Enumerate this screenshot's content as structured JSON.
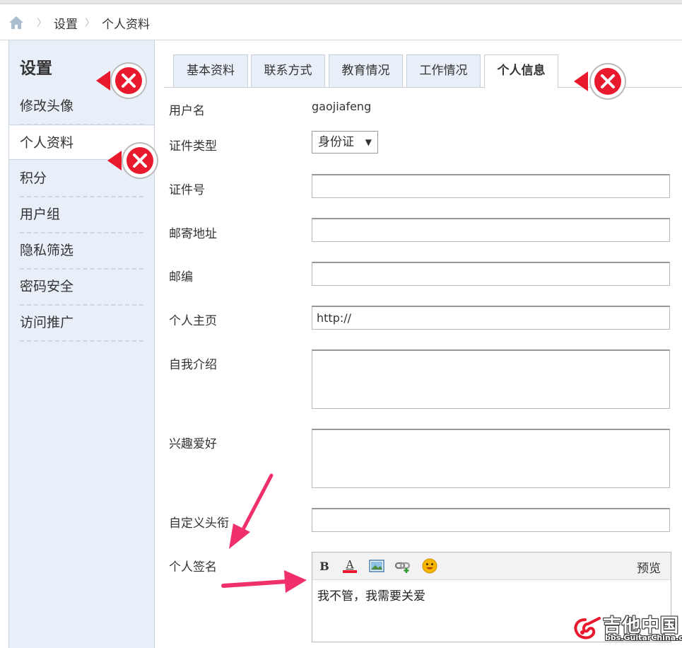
{
  "breadcrumb": {
    "items": [
      "设置",
      "个人资料"
    ]
  },
  "sidebar": {
    "title": "设置",
    "items": [
      {
        "label": "修改头像"
      },
      {
        "label": "个人资料"
      },
      {
        "label": "积分"
      },
      {
        "label": "用户组"
      },
      {
        "label": "隐私筛选"
      },
      {
        "label": "密码安全"
      },
      {
        "label": "访问推广"
      }
    ],
    "active_index": 1
  },
  "tabs": [
    {
      "label": "基本资料"
    },
    {
      "label": "联系方式"
    },
    {
      "label": "教育情况"
    },
    {
      "label": "工作情况"
    },
    {
      "label": "个人信息"
    }
  ],
  "form": {
    "username_label": "用户名",
    "username_value": "gaojiafeng",
    "idtype_label": "证件类型",
    "idtype_value": "身份证",
    "idnumber_label": "证件号",
    "idnumber_value": "",
    "address_label": "邮寄地址",
    "address_value": "",
    "zipcode_label": "邮编",
    "zipcode_value": "",
    "homepage_label": "个人主页",
    "homepage_value": "http://",
    "bio_label": "自我介绍",
    "bio_value": "",
    "hobby_label": "兴趣爱好",
    "hobby_value": "",
    "custom_title_label": "自定义头衔",
    "custom_title_value": "",
    "signature_label": "个人签名"
  },
  "editor": {
    "bold_label": "B",
    "color_label": "A",
    "preview_label": "预览",
    "content": "我不管，我需要关爱"
  },
  "watermark": {
    "main": "吉他中国",
    "sub": "bbs.GuitarChina.com"
  },
  "colors": {
    "sidebar_bg": "#e8eff8",
    "badge_red": "#e8192c",
    "arrow_pink": "#f0306a"
  }
}
